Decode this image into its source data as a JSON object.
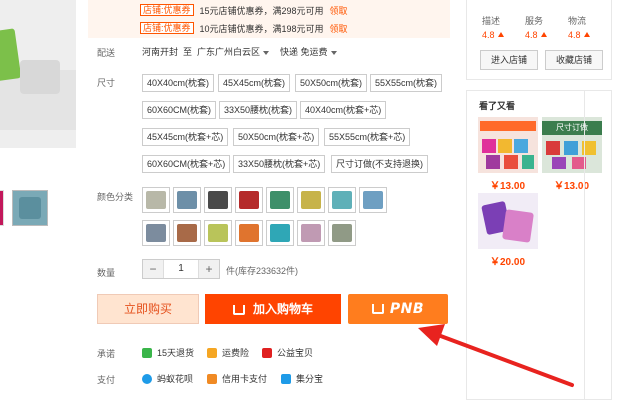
{
  "coupons": [
    {
      "tag": "店铺:优惠券",
      "desc": "15元店铺优惠券，满298元可用",
      "link": "领取"
    },
    {
      "tag": "店铺:优惠券",
      "desc": "10元店铺优惠券，满198元可用",
      "link": "领取"
    }
  ],
  "delivery": {
    "label": "配送",
    "from": "河南开封",
    "to_word": "至",
    "to": "广东广州白云区",
    "shipping": "快递 免运费"
  },
  "size": {
    "label": "尺寸",
    "options": [
      "40X40cm(枕套)",
      "45X45cm(枕套)",
      "50X50cm(枕套)",
      "55X55cm(枕套)",
      "60X60CM(枕套)",
      "33X50腰枕(枕套)",
      "40X40cm(枕套+芯)",
      "45X45cm(枕套+芯)",
      "50X50cm(枕套+芯)",
      "55X55cm(枕套+芯)",
      "60X60CM(枕套+芯)",
      "33X50腰枕(枕套+芯)",
      "尺寸订做(不支持退换)"
    ]
  },
  "colors": {
    "label": "颜色分类",
    "swatches": [
      "#b8b8a8",
      "#6d8fa8",
      "#4a4a4a",
      "#b52a2a",
      "#3d8f6a",
      "#c7b34a",
      "#5fb0b8",
      "#6e9fc2",
      "#7c8c9e",
      "#a86a48",
      "#b9c45a",
      "#e0742e",
      "#2fa7b6",
      "#c09ab3",
      "#909a86"
    ]
  },
  "quantity": {
    "label": "数量",
    "value": "1",
    "minus": "−",
    "plus": "+",
    "stock": "件(库存233632件)"
  },
  "actions": {
    "buy_now": "立即购买",
    "add_cart": "加入购物车",
    "pnb": "PNB"
  },
  "promise": {
    "label": "承诺",
    "items": [
      "15天退货",
      "运费险",
      "公益宝贝"
    ]
  },
  "payment": {
    "label": "支付",
    "items": [
      "蚂蚁花呗",
      "信用卡支付",
      "集分宝"
    ]
  },
  "shop": {
    "scores": [
      {
        "name": "描述",
        "value": "4.8"
      },
      {
        "name": "服务",
        "value": "4.8"
      },
      {
        "name": "物流",
        "value": "4.8"
      }
    ],
    "enter_btn": "进入店铺",
    "fav_btn": "收藏店铺"
  },
  "also_viewed": {
    "title": "看了又看",
    "items": [
      {
        "price": "￥13.00",
        "badge": ""
      },
      {
        "price": "￥13.00",
        "badge": "尺寸订做"
      },
      {
        "price": "￥20.00",
        "badge": ""
      }
    ]
  },
  "colors_theme": {
    "accent": "#ff4400",
    "pnb": "#ff7d1e",
    "buy_bg": "#ffe4d0",
    "arrow": "#e8231f"
  }
}
